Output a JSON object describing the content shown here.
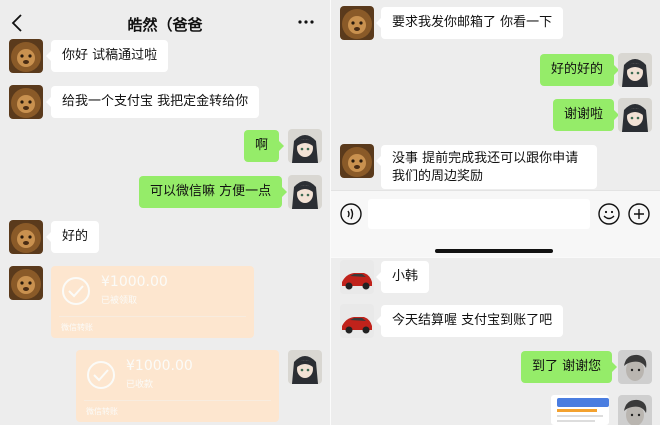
{
  "left": {
    "title": "皓然（爸爸",
    "messages": [
      "你好 试稿通过啦",
      "给我一个支付宝 我把定金转给你",
      "啊",
      "可以微信嘛 方便一点",
      "好的"
    ],
    "transfers": [
      {
        "amount": "¥1000.00",
        "status": "已被领取",
        "footer": "微信转账"
      },
      {
        "amount": "¥1000.00",
        "status": "已收款",
        "footer": "微信转账"
      }
    ]
  },
  "right_top": {
    "messages": [
      "要求我发你邮箱了 你看一下",
      "好的好的",
      "谢谢啦",
      "没事 提前完成我还可以跟你申请我们的周边奖励"
    ],
    "input": {
      "value": ""
    }
  },
  "right_bottom": {
    "messages": [
      "小韩",
      "今天结算喔 支付宝到账了吧",
      "到了 谢谢您"
    ]
  },
  "icons": [
    "back-icon",
    "more-icon",
    "voice-icon",
    "emoji-icon",
    "plus-icon",
    "check-circle-icon"
  ]
}
